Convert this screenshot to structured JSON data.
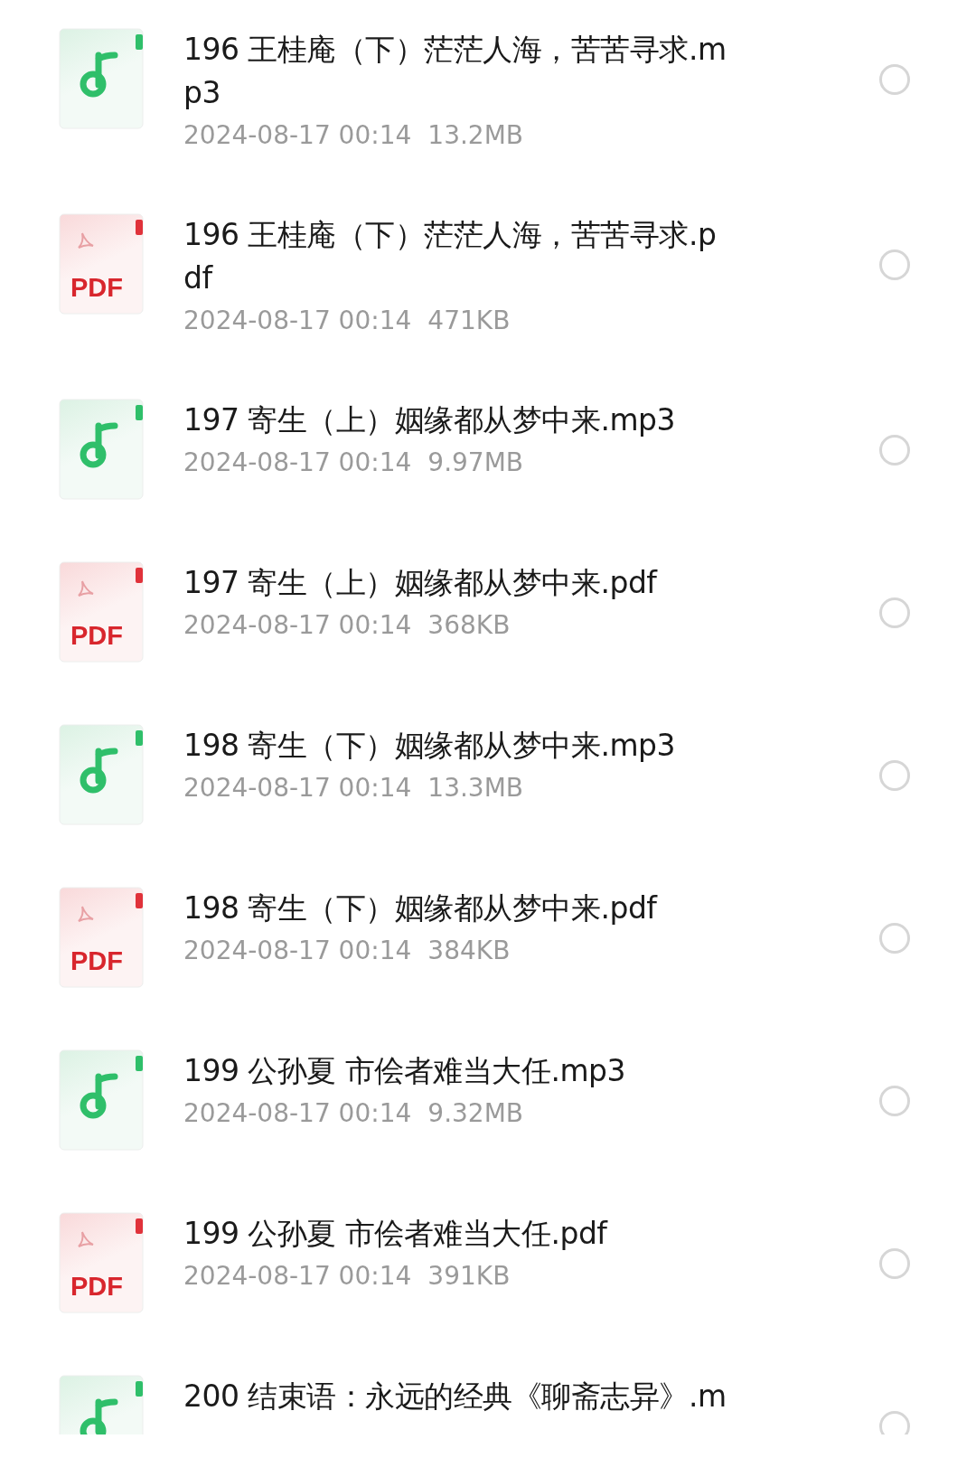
{
  "files": [
    {
      "kind": "audio",
      "name_lines": [
        "196 王桂庵（下）茫茫人海，苦苦寻求.m",
        "p3"
      ],
      "date": "2024-08-17 00:14",
      "size": "13.2MB",
      "selected": false
    },
    {
      "kind": "pdf",
      "badge": "PDF",
      "name_lines": [
        "196 王桂庵（下）茫茫人海，苦苦寻求.p",
        "df"
      ],
      "date": "2024-08-17 00:14",
      "size": "471KB",
      "selected": false
    },
    {
      "kind": "audio",
      "name_lines": [
        "197 寄生（上）姻缘都从梦中来.mp3"
      ],
      "date": "2024-08-17 00:14",
      "size": "9.97MB",
      "selected": false
    },
    {
      "kind": "pdf",
      "badge": "PDF",
      "name_lines": [
        "197 寄生（上）姻缘都从梦中来.pdf"
      ],
      "date": "2024-08-17 00:14",
      "size": "368KB",
      "selected": false
    },
    {
      "kind": "audio",
      "name_lines": [
        "198 寄生（下）姻缘都从梦中来.mp3"
      ],
      "date": "2024-08-17 00:14",
      "size": "13.3MB",
      "selected": false
    },
    {
      "kind": "pdf",
      "badge": "PDF",
      "name_lines": [
        "198 寄生（下）姻缘都从梦中来.pdf"
      ],
      "date": "2024-08-17 00:14",
      "size": "384KB",
      "selected": false
    },
    {
      "kind": "audio",
      "name_lines": [
        "199 公孙夏 市侩者难当大任.mp3"
      ],
      "date": "2024-08-17 00:14",
      "size": "9.32MB",
      "selected": false
    },
    {
      "kind": "pdf",
      "badge": "PDF",
      "name_lines": [
        "199 公孙夏 市侩者难当大任.pdf"
      ],
      "date": "2024-08-17 00:14",
      "size": "391KB",
      "selected": false
    },
    {
      "kind": "audio",
      "name_lines": [
        "200 结束语：永远的经典《聊斋志异》.m"
      ],
      "selected": false
    }
  ]
}
